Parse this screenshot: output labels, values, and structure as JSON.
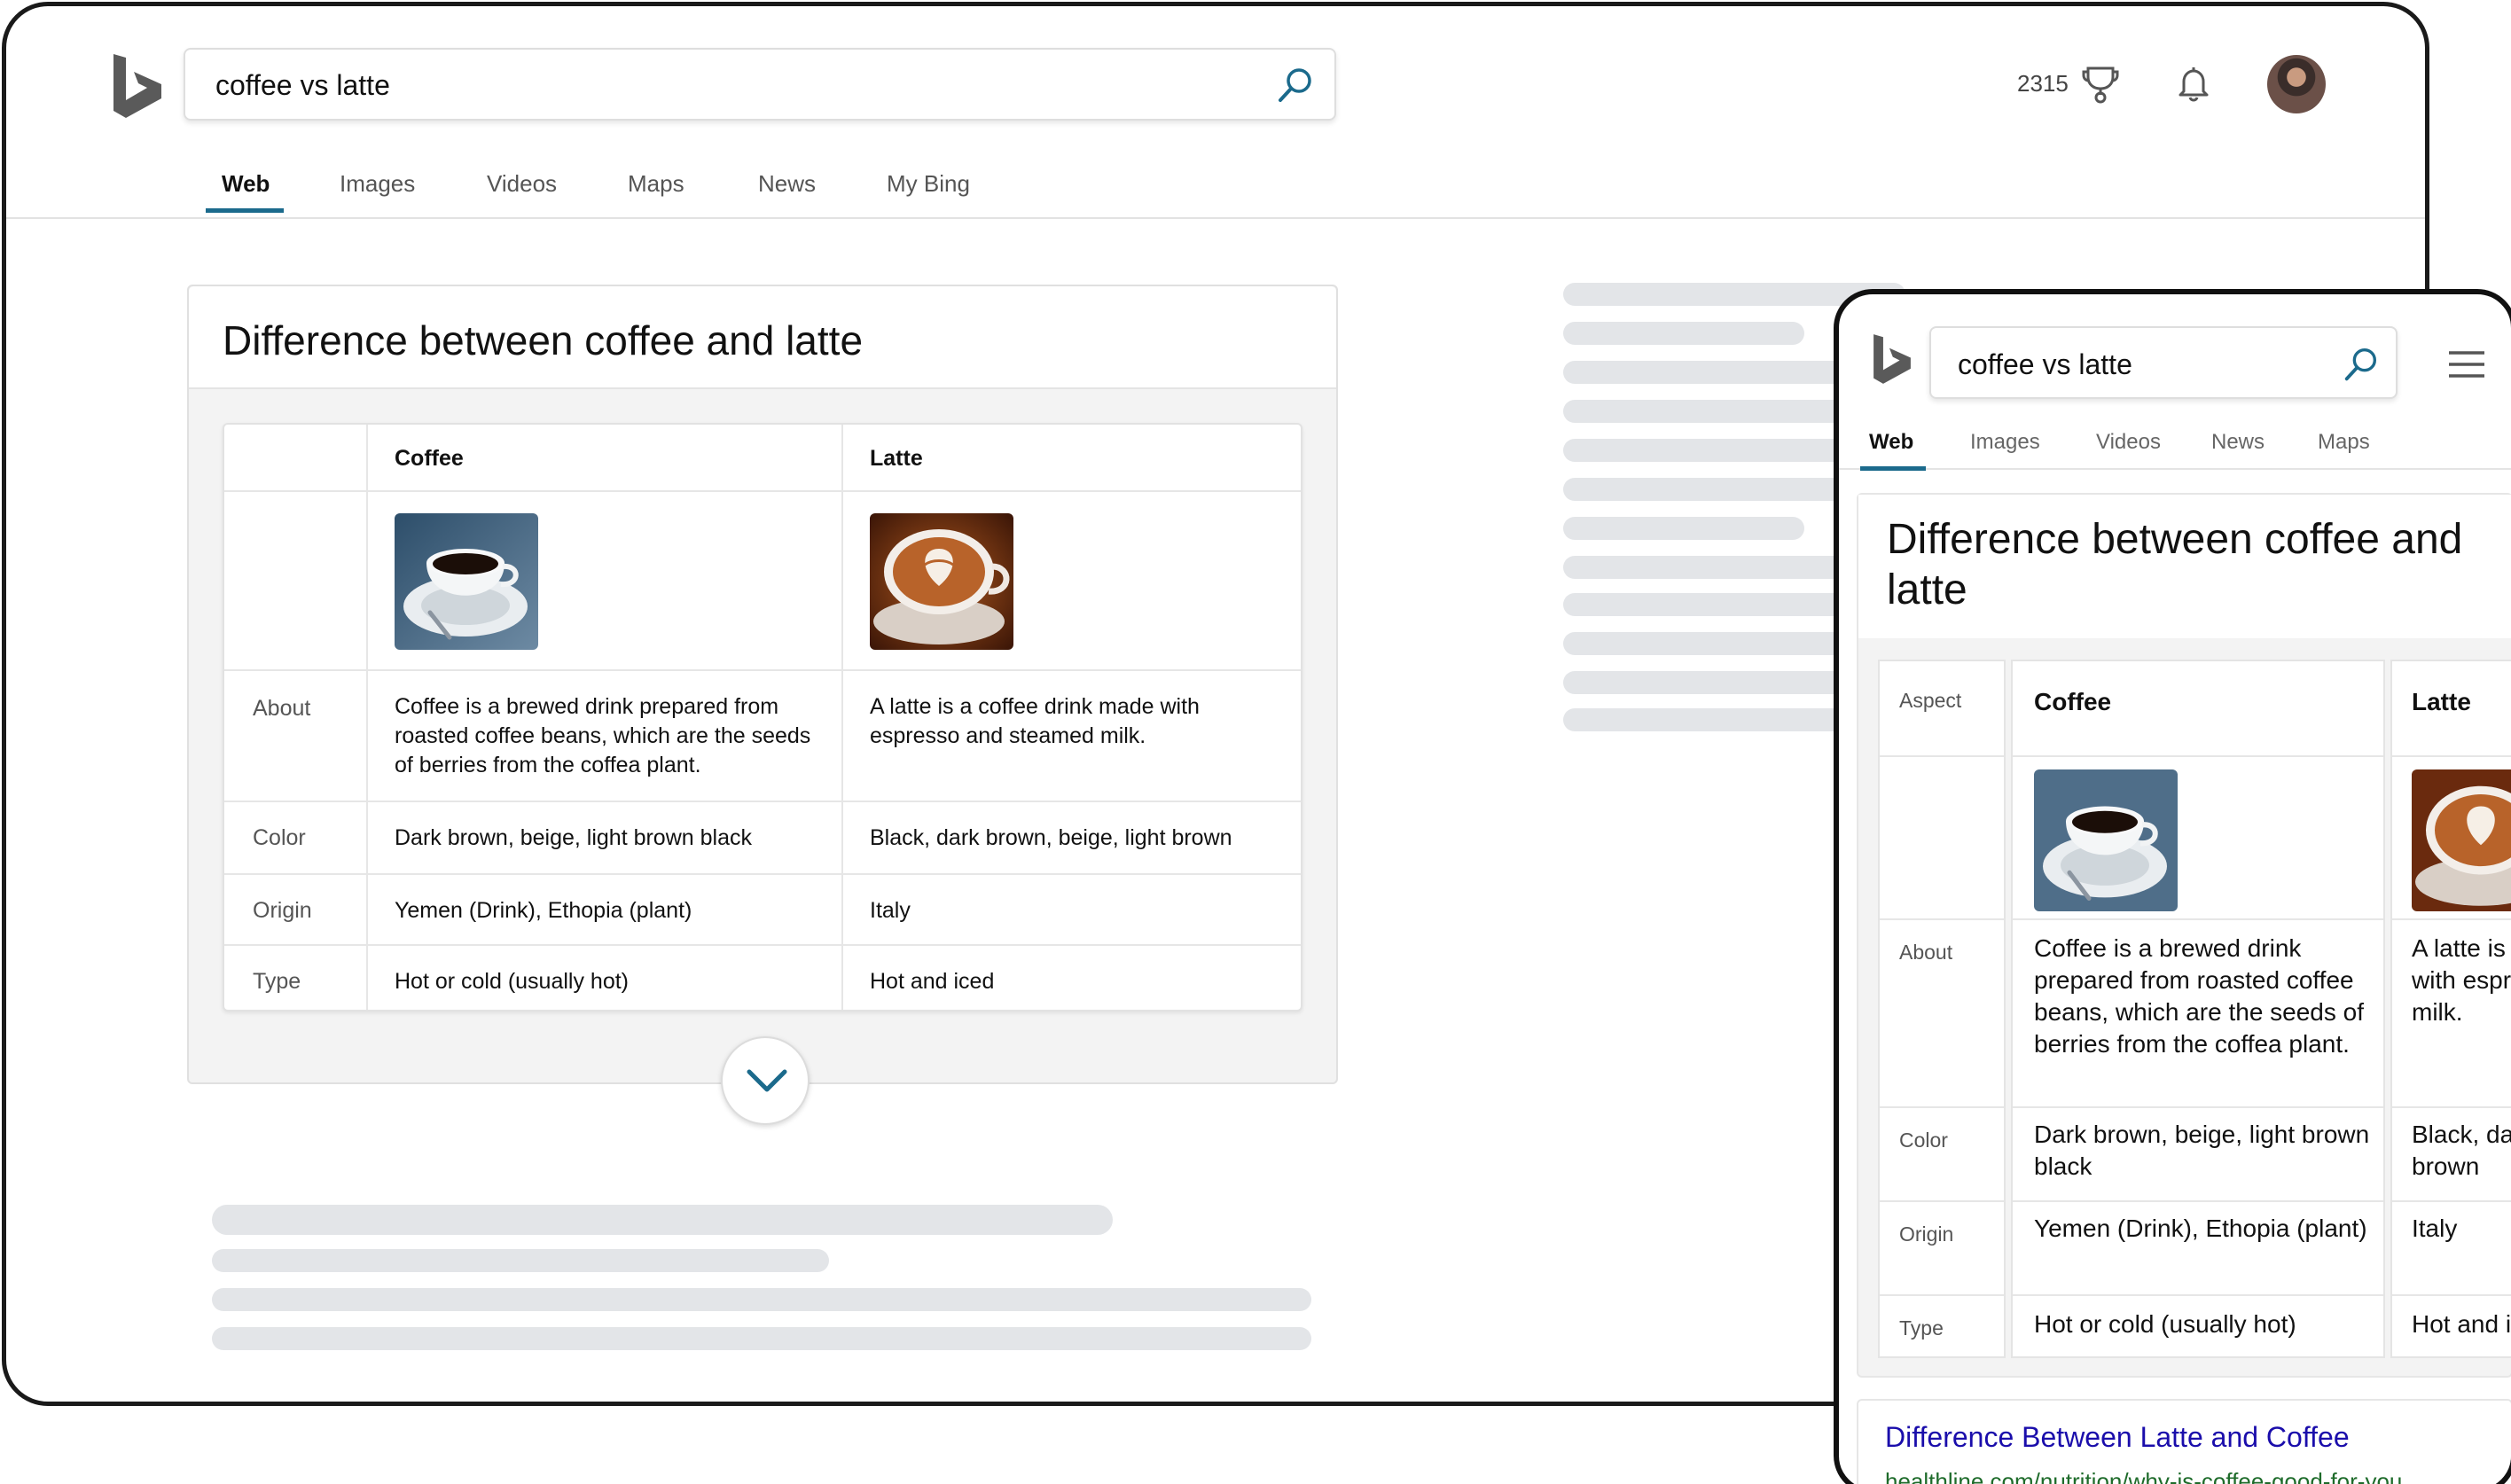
{
  "colors": {
    "accent": "#1b6a8c",
    "link": "#1a0dab",
    "url": "#1e6b2a",
    "skeleton": "#e3e5e8",
    "card_bg": "#f3f3f3"
  },
  "desktop": {
    "search": {
      "query": "coffee vs latte"
    },
    "rewards_points": "2315",
    "icons": [
      "bing-logo-icon",
      "search-icon",
      "trophy-icon",
      "bell-icon",
      "avatar"
    ],
    "tabs": [
      "Web",
      "Images",
      "Videos",
      "Maps",
      "News",
      "My Bing"
    ],
    "active_tab": "Web",
    "card": {
      "title": "Difference between coffee and latte",
      "columns": [
        "Coffee",
        "Latte"
      ],
      "rows": [
        {
          "label": "About",
          "coffee": "Coffee is a brewed drink prepared from roasted coffee beans, which are the seeds of berries from the coffea plant.",
          "latte": "A latte is a coffee drink made with espresso and steamed milk."
        },
        {
          "label": "Color",
          "coffee": "Dark brown, beige, light brown black",
          "latte": "Black, dark brown, beige, light brown"
        },
        {
          "label": "Origin",
          "coffee": "Yemen (Drink), Ethopia (plant)",
          "latte": "Italy"
        },
        {
          "label": "Type",
          "coffee": "Hot or cold (usually hot)",
          "latte": "Hot and iced"
        }
      ]
    }
  },
  "mobile": {
    "search": {
      "query": "coffee vs latte"
    },
    "tabs": [
      "Web",
      "Images",
      "Videos",
      "News",
      "Maps"
    ],
    "active_tab": "Web",
    "card": {
      "title": "Difference between coffee and latte",
      "aspect_label": "Aspect",
      "columns": [
        "Coffee",
        "Latte"
      ],
      "rows": [
        {
          "label": "About",
          "coffee": "Coffee is a brewed drink prepared from roasted coffee beans, which are the seeds of berries from the coffea plant.",
          "latte": "A latte is a coffee drink made with espresso and steamed milk."
        },
        {
          "label": "Color",
          "coffee": "Dark brown, beige, light brown black",
          "latte": "Black, dark brown, beige, light brown"
        },
        {
          "label": "Origin",
          "coffee": "Yemen (Drink), Ethopia (plant)",
          "latte": "Italy"
        },
        {
          "label": "Type",
          "coffee": "Hot or cold (usually hot)",
          "latte": "Hot and iced"
        }
      ]
    },
    "result": {
      "link": "Difference Between Latte and Coffee",
      "url": "healthline.com/nutrition/why-is-coffee-good-for-you"
    }
  }
}
